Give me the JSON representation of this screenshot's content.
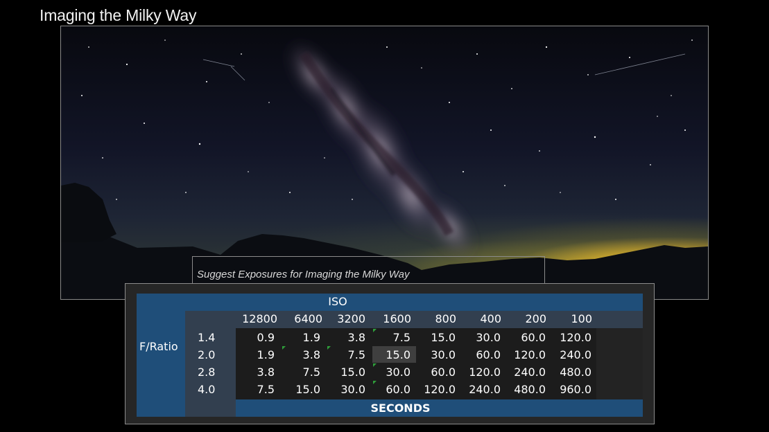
{
  "slide": {
    "title": "Imaging the Milky Way"
  },
  "caption": "Suggest Exposures for Imaging the Milky Way",
  "table": {
    "top_header": "ISO",
    "side_header": "F/Ratio",
    "bottom_label": "SECONDS",
    "iso_values": [
      "12800",
      "6400",
      "3200",
      "1600",
      "800",
      "400",
      "200",
      "100"
    ],
    "rows": [
      {
        "f": "1.4",
        "values": [
          "0.9",
          "1.9",
          "3.8",
          "7.5",
          "15.0",
          "30.0",
          "60.0",
          "120.0"
        ]
      },
      {
        "f": "2.0",
        "values": [
          "1.9",
          "3.8",
          "7.5",
          "15.0",
          "30.0",
          "60.0",
          "120.0",
          "240.0"
        ]
      },
      {
        "f": "2.8",
        "values": [
          "3.8",
          "7.5",
          "15.0",
          "30.0",
          "60.0",
          "120.0",
          "240.0",
          "480.0"
        ]
      },
      {
        "f": "4.0",
        "values": [
          "7.5",
          "15.0",
          "30.0",
          "60.0",
          "120.0",
          "240.0",
          "480.0",
          "960.0"
        ]
      }
    ],
    "highlighted_cell": {
      "row": 1,
      "col": 3
    },
    "colors": {
      "header_blue": "#1f4e79",
      "header_grey": "#323f4f",
      "cell_dark": "#1c1c1c",
      "highlight": "#3f3f3f",
      "comment_marker": "#2e9e3a"
    }
  },
  "photo": {
    "subject": "milky-way-night-sky-over-mountains"
  }
}
